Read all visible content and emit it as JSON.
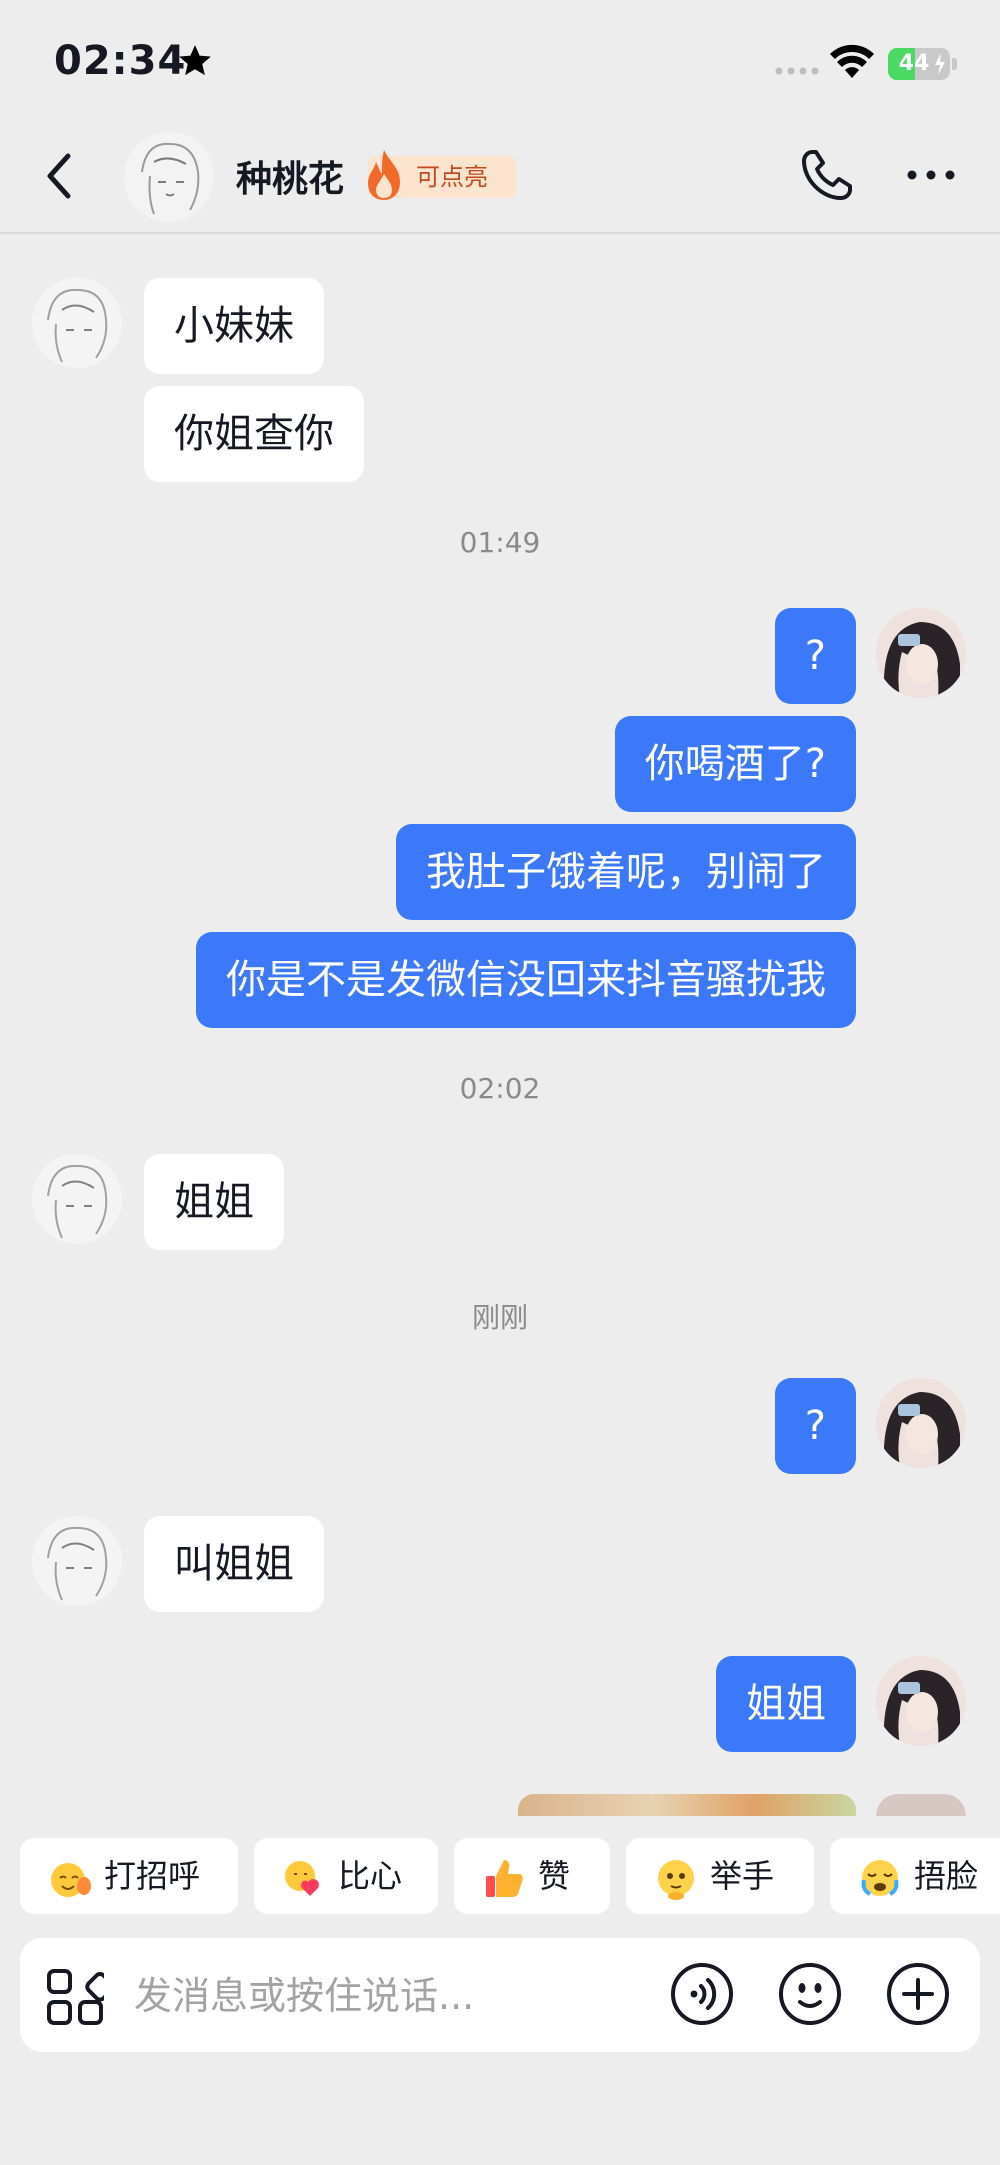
{
  "status_bar": {
    "time": "02:34",
    "battery": "44",
    "battery_level": 0.44
  },
  "header": {
    "contact_name": "种桃花",
    "flame_label": "可点亮"
  },
  "messages": {
    "m1": "小妹妹",
    "m2": "你姐查你",
    "ts1": "01:49",
    "m3": "?",
    "m4": "你喝酒了?",
    "m5": "我肚子饿着呢，别闹了",
    "m6": "你是不是发微信没回来抖音骚扰我",
    "ts2": "02:02",
    "m7": "姐姐",
    "ts3": "刚刚",
    "m8": "?",
    "m9": "叫姐姐",
    "m10": "姐姐"
  },
  "quick_replies": [
    {
      "label": "打招呼",
      "icon": "wave-emoji-icon"
    },
    {
      "label": "比心",
      "icon": "heart-hands-emoji-icon"
    },
    {
      "label": "赞",
      "icon": "thumbs-up-emoji-icon"
    },
    {
      "label": "举手",
      "icon": "raise-hand-emoji-icon"
    },
    {
      "label": "捂脸",
      "icon": "facepalm-emoji-icon"
    }
  ],
  "input": {
    "placeholder": "发消息或按住说话..."
  },
  "colors": {
    "outgoing_bubble": "#3b78fa",
    "incoming_bubble": "#ffffff",
    "background": "#ededed"
  }
}
